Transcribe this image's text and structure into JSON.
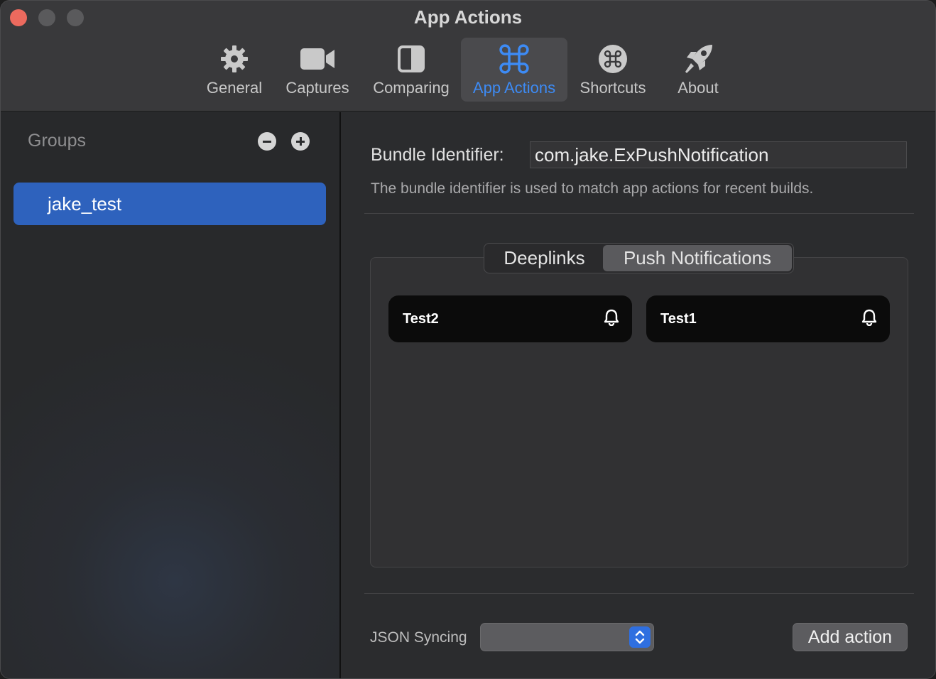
{
  "window": {
    "title": "App Actions"
  },
  "toolbar": {
    "tabs": [
      {
        "label": "General",
        "icon": "gear-icon"
      },
      {
        "label": "Captures",
        "icon": "video-camera-icon"
      },
      {
        "label": "Comparing",
        "icon": "split-view-icon"
      },
      {
        "label": "App Actions",
        "icon": "command-icon",
        "active": true
      },
      {
        "label": "Shortcuts",
        "icon": "command-circle-icon"
      },
      {
        "label": "About",
        "icon": "rocket-icon"
      }
    ]
  },
  "sidebar": {
    "title": "Groups",
    "groups": [
      {
        "label": "jake_test",
        "selected": true
      }
    ]
  },
  "main": {
    "bundle_label": "Bundle Identifier:",
    "bundle_value": "com.jake.ExPushNotification",
    "bundle_help": "The bundle identifier is used to match app actions for recent builds.",
    "segments": [
      {
        "label": "Deeplinks"
      },
      {
        "label": "Push Notifications",
        "selected": true
      }
    ],
    "actions": [
      {
        "name": "Test2",
        "icon": "bell-icon"
      },
      {
        "name": "Test1",
        "icon": "bell-icon"
      }
    ],
    "json_syncing_label": "JSON Syncing",
    "json_syncing_value": "",
    "add_action_label": "Add action"
  },
  "colors": {
    "accent": "#3d8bf5",
    "selection": "#2e62bd",
    "close": "#ec6a5e"
  }
}
